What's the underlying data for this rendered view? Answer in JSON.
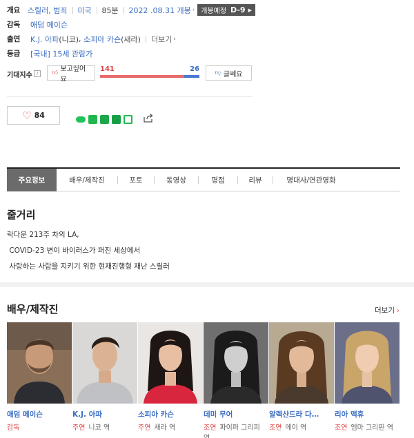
{
  "info": {
    "overview_label": "개요",
    "genre": "스릴러, 범죄",
    "country": "미국",
    "runtime": "85분",
    "release": "2022 .08.31 개봉",
    "release_sep": "·",
    "dday_label": "개봉예정",
    "dday_value": "D-9",
    "director_label": "감독",
    "director": "애덤 메이슨",
    "cast_label": "출연",
    "cast_1": "K.J. 아파",
    "cast_1_role": "(니코)",
    "cast_2": "소피아 카슨",
    "cast_2_role": "(새라)",
    "cast_more": "더보기",
    "rating_label": "등급",
    "rating": "[국내] 15세 관람가"
  },
  "expectation": {
    "label": "기대지수",
    "help": "?",
    "want_label": "보고싶어요",
    "want_count": "141",
    "no_count": "26",
    "no_label": "글쎄요",
    "want_ratio": 0.844
  },
  "actions": {
    "like_count": "84"
  },
  "tabs": [
    "주요정보",
    "배우/제작진",
    "포토",
    "동영상",
    "평점",
    "리뷰",
    "명대사/연관영화"
  ],
  "synopsis": {
    "title": "줄거리",
    "lines": [
      "락다운 213주 차의 LA,",
      " COVID-23 변이 바이러스가 퍼진 세상에서",
      " 사랑하는 사람을 지키기 위한 현재진행형 재난 스릴러"
    ]
  },
  "cast_section": {
    "title": "배우/제작진",
    "more": "더보기",
    "people": [
      {
        "name": "애덤 메이슨",
        "role_type": "감독",
        "role": ""
      },
      {
        "name": "K.J. 아파",
        "role_type": "주연",
        "role": "니코 역"
      },
      {
        "name": "소피아 카슨",
        "role_type": "주연",
        "role": "새라 역"
      },
      {
        "name": "데미 무어",
        "role_type": "조연",
        "role": "파이퍼 그리피 역"
      },
      {
        "name": "알렉산드라 다…",
        "role_type": "조연",
        "role": "메이 역"
      },
      {
        "name": "리아 맥휴",
        "role_type": "조연",
        "role": "엠마 그리핀 역"
      }
    ]
  },
  "colors": {
    "link": "#3b6ec2",
    "accent_red": "#e04646",
    "gauge_red": "#e86b6b",
    "gauge_blue": "#4a78d2",
    "active_tab": "#6b6b6b"
  }
}
